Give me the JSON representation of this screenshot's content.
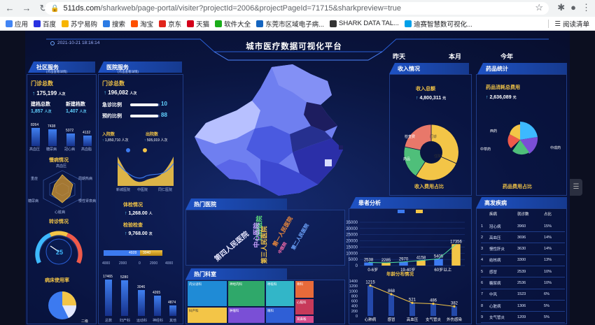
{
  "browser": {
    "url_host": "511ds.com",
    "url_path": "/sharkweb/page-portal/visiter?projectId=2006&projectPageId=71715&sharkpreview=true",
    "bookmarks": [
      "应用",
      "百度",
      "苏宁易购",
      "搜索",
      "淘宝",
      "京东",
      "天猫",
      "软件大全",
      "东莞市区域电子病...",
      "SHARK DATA TAL...",
      "迪赛智慧数可视化..."
    ],
    "reading_list": "阅读清单"
  },
  "header": {
    "title": "城市医疗数据可视化平台",
    "timestamp": "2021-10-21 18:16:14",
    "periods": [
      "昨天",
      "本月",
      "今年"
    ]
  },
  "community": {
    "title": "社区服务",
    "subtitle": "(点击查看详情)",
    "outpatient_label": "门诊总数",
    "outpatient_value": "175,199",
    "outpatient_unit": "人次",
    "files_label": "建档总数",
    "files_value": "1,857",
    "files_unit": "人次",
    "new_files_label": "新建档数",
    "new_files_value": "1,407",
    "new_files_unit": "人次",
    "bar_values": [
      "8264",
      "7438",
      "5372",
      "4132"
    ],
    "bar_labels": [
      "高血压",
      "糖尿病",
      "冠心病",
      "高血脂"
    ],
    "chronic_title": "慢病情况",
    "radar_labels": [
      "高血压",
      "周期热病",
      "慢性肾衰病",
      "心脏病",
      "糖尿病",
      "重症"
    ],
    "referral_title": "转诊情况",
    "gauge_value": "25",
    "bed_title": "病床使用率",
    "pie_labels": [
      "二级"
    ]
  },
  "hospital": {
    "title": "医院服务",
    "subtitle": "(点击查看详情)",
    "outpatient_label": "门诊总数",
    "outpatient_value": "196,082",
    "outpatient_unit": "人次",
    "emergency_label": "急诊比例",
    "emergency_value": "10",
    "appointment_label": "预约比例",
    "appointment_value": "88",
    "admit_label": "入院数",
    "admit_value": "1,850,710",
    "admit_unit": "人次",
    "discharge_label": "出院数",
    "discharge_value": "505,019",
    "discharge_unit": "人次",
    "area_axis": [
      "新城医院",
      "中医院",
      "同仁医院"
    ],
    "exam_label": "体检情况",
    "exam_value": "1,268.00",
    "exam_unit": "人",
    "check_label": "检验检查",
    "check_value": "9,768.00",
    "check_unit": "次",
    "hbar_left": "4928",
    "hbar_right": "3040",
    "hbar_axis": [
      "4000",
      "2000",
      "0",
      "2000",
      "4000"
    ],
    "dept_values": [
      "17465",
      "5280",
      "3046",
      "4265",
      "4874"
    ],
    "dept_labels": [
      "总数",
      "妇产科",
      "运动科",
      "神经科",
      "其他"
    ]
  },
  "hot_hospital": {
    "title": "热门医院",
    "words": [
      "第四人民医院",
      "口腔医院",
      "中心医院",
      "第三人民医院",
      "第一人民医院",
      "第二人民医院",
      "中医院"
    ]
  },
  "hot_dept": {
    "title": "热门科室",
    "cells": [
      "内分泌科",
      "神经内科",
      "呼吸科",
      "骨科",
      "心脑科",
      "妇产科",
      "肿瘤科",
      "眼科",
      "耳鼻喉"
    ]
  },
  "income": {
    "title": "收入情况",
    "total_label": "收入总额",
    "total_value": "4,800,311",
    "total_unit": "元",
    "sunburst_title": "收入费用占比",
    "sunburst_labels": [
      "门诊",
      "住院",
      "药品",
      "检查费"
    ]
  },
  "drug": {
    "title": "药品统计",
    "total_label": "药品消耗总费用",
    "total_value": "2,636,089",
    "total_unit": "元",
    "pie_title": "药品费用占比",
    "pie_labels": [
      "西药",
      "中成药",
      "中草药"
    ]
  },
  "patient": {
    "title": "患者分析",
    "age_title": "年龄分布情况",
    "chart_data": {
      "type": "bar",
      "categories": [
        "0-6岁",
        "",
        "19-40岁",
        "",
        "60岁以上",
        ""
      ],
      "values": [
        2538,
        2285,
        2970,
        4158,
        5405,
        17356
      ],
      "ylim": [
        0,
        35000
      ],
      "yticks": [
        0,
        5000,
        10000,
        15000,
        20000,
        25000,
        30000,
        35000
      ]
    },
    "chart2": {
      "type": "line",
      "categories": [
        "心肺病",
        "感冒",
        "高血压",
        "支气管炎",
        "外伤感染"
      ],
      "values": [
        1215,
        868,
        521,
        486,
        382
      ],
      "yticks": [
        0,
        200,
        400,
        600,
        800,
        1000,
        1200,
        1400
      ]
    }
  },
  "disease": {
    "title": "高发疾病",
    "headers": [
      "疾病",
      "就诊数",
      "占比"
    ],
    "rows": [
      [
        "1",
        "冠心病",
        "3960",
        "15%"
      ],
      [
        "2",
        "高血压",
        "3696",
        "14%"
      ],
      [
        "3",
        "慢性肝炎",
        "3630",
        "14%"
      ],
      [
        "4",
        "结核病",
        "3300",
        "13%"
      ],
      [
        "5",
        "感冒",
        "2539",
        "10%"
      ],
      [
        "6",
        "糖尿病",
        "2536",
        "10%"
      ],
      [
        "7",
        "中风",
        "1523",
        "6%"
      ],
      [
        "8",
        "心脏病",
        "1306",
        "5%"
      ],
      [
        "9",
        "支气管炎",
        "1209",
        "5%"
      ]
    ]
  }
}
